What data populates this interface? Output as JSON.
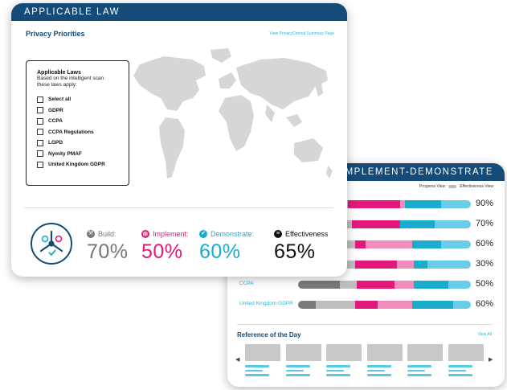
{
  "back_card": {
    "title": "BUILD-IMPLEMENT-DEMONSTRATE",
    "toggle": {
      "left_label": "Progress View",
      "right_label": "Effectiveness View"
    },
    "rows": [
      {
        "label": "",
        "percent": "90%",
        "segments": [
          [
            "#7a7a7a",
            0.26
          ],
          [
            "#bdbdbd",
            0.03
          ],
          [
            "#e2187b",
            0.3
          ],
          [
            "#f28cbc",
            0.03
          ],
          [
            "#1aaccd",
            0.21
          ],
          [
            "#69cce8",
            0.17
          ]
        ]
      },
      {
        "label": "",
        "percent": "70%",
        "segments": [
          [
            "#7a7a7a",
            0.26
          ],
          [
            "#bdbdbd",
            0.05
          ],
          [
            "#e2187b",
            0.28
          ],
          [
            "#f28cbc",
            0.0
          ],
          [
            "#1aaccd",
            0.2
          ],
          [
            "#69cce8",
            0.21
          ]
        ]
      },
      {
        "label": "",
        "percent": "60%",
        "segments": [
          [
            "#7a7a7a",
            0.26
          ],
          [
            "#bdbdbd",
            0.07
          ],
          [
            "#e2187b",
            0.06
          ],
          [
            "#f28cbc",
            0.27
          ],
          [
            "#1aaccd",
            0.17
          ],
          [
            "#69cce8",
            0.17
          ]
        ]
      },
      {
        "label": "",
        "percent": "30%",
        "segments": [
          [
            "#7a7a7a",
            0.26
          ],
          [
            "#bdbdbd",
            0.07
          ],
          [
            "#e2187b",
            0.24
          ],
          [
            "#f28cbc",
            0.1
          ],
          [
            "#1aaccd",
            0.08
          ],
          [
            "#69cce8",
            0.25
          ]
        ]
      },
      {
        "label": "CCPA",
        "percent": "50%",
        "segments": [
          [
            "#7a7a7a",
            0.24
          ],
          [
            "#bdbdbd",
            0.1
          ],
          [
            "#e2187b",
            0.22
          ],
          [
            "#f28cbc",
            0.11
          ],
          [
            "#1aaccd",
            0.2
          ],
          [
            "#69cce8",
            0.13
          ]
        ]
      },
      {
        "label": "United Kingdom GDPR",
        "percent": "60%",
        "segments": [
          [
            "#7a7a7a",
            0.1
          ],
          [
            "#bdbdbd",
            0.23
          ],
          [
            "#e2187b",
            0.13
          ],
          [
            "#f28cbc",
            0.2
          ],
          [
            "#1aaccd",
            0.24
          ],
          [
            "#69cce8",
            0.1
          ]
        ]
      }
    ],
    "reference": {
      "title": "Reference of the Day",
      "view_all": "View All",
      "thumb_count": 6
    }
  },
  "front_card": {
    "title": "APPLICABLE LAW",
    "section_title": "Privacy Priorities",
    "summary_link": "View PrivacyCentral Summary Page",
    "laws_box": {
      "title": "Applicable Laws",
      "description": "Based on the intelligent scan these laws apply:",
      "items": [
        "Select all",
        "GDPR",
        "CCPA",
        "CCPA Regulations",
        "LGPD",
        "Nymity PMAF",
        "United Kingdom GDPR"
      ]
    },
    "metrics": [
      {
        "label": "Build:",
        "value": "70%",
        "color": "#777777",
        "icon": "wrench-icon"
      },
      {
        "label": "Implement:",
        "value": "50%",
        "color": "#e2187b",
        "icon": "gear-icon"
      },
      {
        "label": "Demonstrate:",
        "value": "60%",
        "color": "#1aaccd",
        "icon": "check-circle-icon"
      },
      {
        "label": "Effectiveness",
        "value": "65%",
        "color": "#111111",
        "icon": "list-icon"
      }
    ]
  }
}
